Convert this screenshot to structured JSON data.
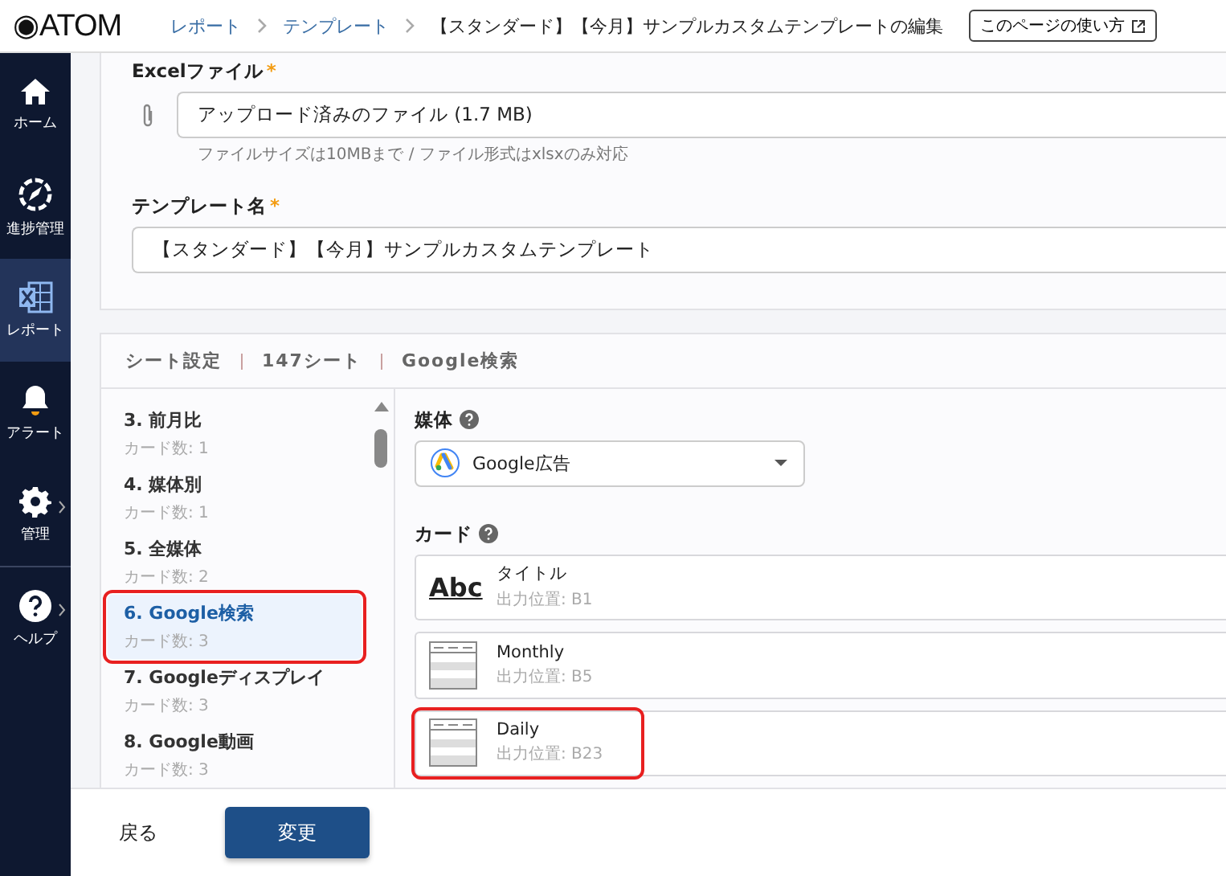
{
  "header": {
    "logo": "◉ATOM",
    "breadcrumbs": [
      "レポート",
      "テンプレート",
      "【スタンダード】【今月】サンプルカスタムテンプレートの編集"
    ],
    "help_button": "このページの使い方"
  },
  "sidebar": {
    "items": [
      {
        "label": "ホーム",
        "selected": false,
        "submenu": false
      },
      {
        "label": "進捗管理",
        "selected": false,
        "submenu": false
      },
      {
        "label": "レポート",
        "selected": true,
        "submenu": false
      },
      {
        "label": "アラート",
        "selected": false,
        "submenu": false
      },
      {
        "label": "管理",
        "selected": false,
        "submenu": true
      },
      {
        "label": "ヘルプ",
        "selected": false,
        "submenu": true
      }
    ]
  },
  "file_form": {
    "excel_label": "Excelファイル",
    "excel_required": "*",
    "excel_value": "アップロード済みのファイル (1.7 MB)",
    "excel_hint": "ファイルサイズは10MBまで / ファイル形式はxlsxのみ対応",
    "name_label": "テンプレート名",
    "name_required": "*",
    "name_value": "【スタンダード】【今月】サンプルカスタムテンプレート"
  },
  "sheet_settings": {
    "tabs": [
      "シート設定",
      "147シート",
      "Google検索"
    ],
    "sheets": [
      {
        "title": "3. 前月比",
        "cards": "カード数: 1",
        "selected": false,
        "highlighted": false
      },
      {
        "title": "4. 媒体別",
        "cards": "カード数: 1",
        "selected": false,
        "highlighted": false
      },
      {
        "title": "5. 全媒体",
        "cards": "カード数: 2",
        "selected": false,
        "highlighted": false
      },
      {
        "title": "6. Google検索",
        "cards": "カード数: 3",
        "selected": true,
        "highlighted": true
      },
      {
        "title": "7. Googleディスプレイ",
        "cards": "カード数: 3",
        "selected": false,
        "highlighted": false
      },
      {
        "title": "8. Google動画",
        "cards": "カード数: 3",
        "selected": false,
        "highlighted": false
      }
    ],
    "media_label": "媒体",
    "media_value": "Google広告",
    "cards_label": "カード",
    "cards": [
      {
        "kind": "text",
        "icon_text": "Abc",
        "name": "タイトル",
        "position": "出力位置: B1",
        "highlighted": false
      },
      {
        "kind": "table",
        "name": "Monthly",
        "position": "出力位置: B5",
        "highlighted": false
      },
      {
        "kind": "table",
        "name": "Daily",
        "position": "出力位置: B23",
        "highlighted": true
      }
    ]
  },
  "footer": {
    "back": "戻る",
    "submit": "変更"
  }
}
